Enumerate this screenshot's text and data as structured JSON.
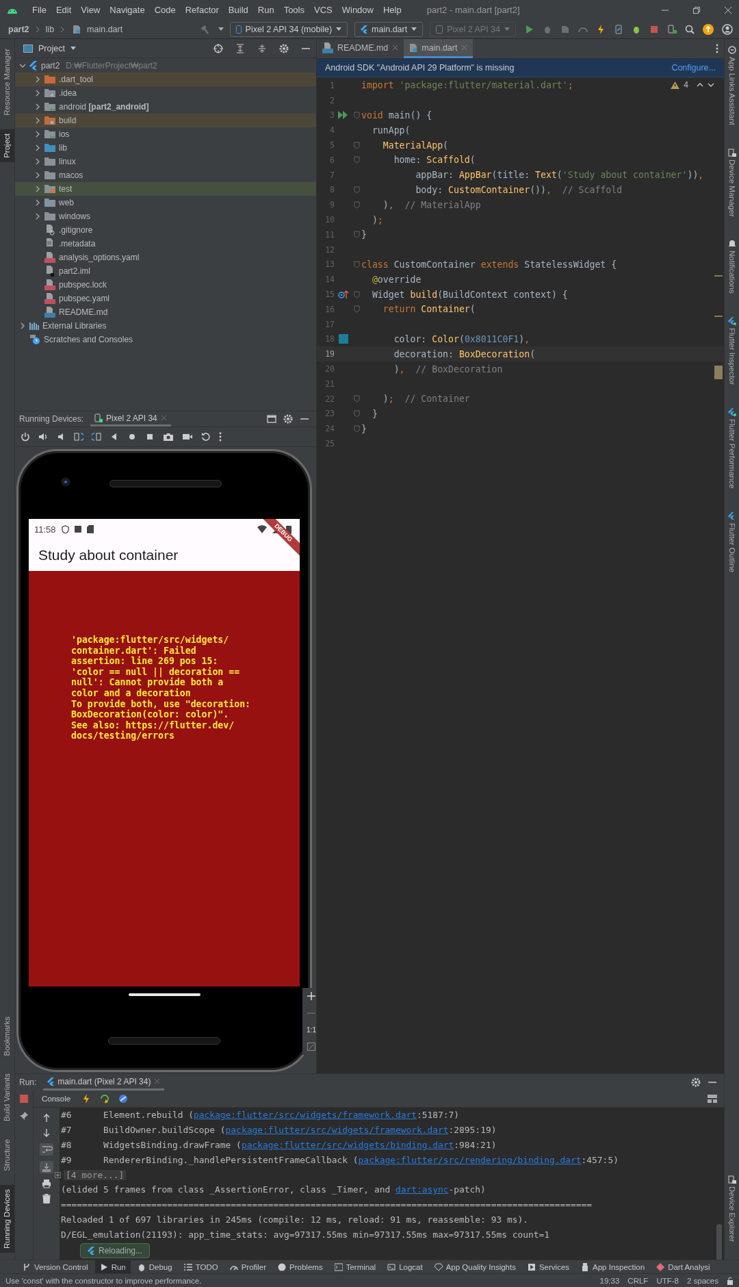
{
  "menu_bar": {
    "items": [
      "File",
      "Edit",
      "View",
      "Navigate",
      "Code",
      "Refactor",
      "Build",
      "Run",
      "Tools",
      "VCS",
      "Window",
      "Help"
    ],
    "title": "part2 - main.dart [part2]"
  },
  "nav_bar": {
    "breadcrumbs": [
      "part2",
      "lib",
      "main.dart"
    ],
    "device": "Pixel 2 API 34 (mobile)",
    "run_config": "main.dart",
    "target": {
      "label": "Pixel 2 API 34",
      "disabled": true
    }
  },
  "left_stripe": {
    "top": [
      {
        "label": "Resource Manager",
        "selected": false
      },
      {
        "label": "Project",
        "selected": true
      }
    ],
    "bottom": [
      {
        "label": "Bookmarks",
        "selected": false
      },
      {
        "label": "Build Variants",
        "selected": false
      },
      {
        "label": "Structure",
        "selected": false
      },
      {
        "label": "Running Devices",
        "selected": true
      }
    ]
  },
  "project": {
    "title": "Project",
    "tree": [
      {
        "label": "part2",
        "path": "D:₩FlutterProject₩part2",
        "kind": "flutter",
        "expanded": true,
        "children": [
          {
            "label": ".dart_tool",
            "kind": "folder-excluded",
            "expanded": false,
            "excluded": true,
            "tests": false
          },
          {
            "label": ".idea",
            "kind": "folder-settings",
            "expanded": false,
            "excluded": false,
            "tests": false
          },
          {
            "label": "android **[part2_android]**",
            "kind": "folder-module",
            "expanded": false,
            "excluded": false,
            "tests": false
          },
          {
            "label": "build",
            "kind": "folder-excluded-settings",
            "expanded": false,
            "excluded": true,
            "tests": false
          },
          {
            "label": "ios",
            "kind": "folder-module",
            "expanded": false,
            "excluded": false,
            "tests": false
          },
          {
            "label": "lib",
            "kind": "folder-source",
            "expanded": false,
            "excluded": false,
            "tests": false
          },
          {
            "label": "linux",
            "kind": "folder",
            "expanded": false,
            "excluded": false,
            "tests": false
          },
          {
            "label": "macos",
            "kind": "folder",
            "expanded": false,
            "excluded": false,
            "tests": false
          },
          {
            "label": "test",
            "kind": "folder-test",
            "expanded": false,
            "excluded": false,
            "tests": true
          },
          {
            "label": "web",
            "kind": "folder-web",
            "expanded": false,
            "excluded": false,
            "tests": false
          },
          {
            "label": "windows",
            "kind": "folder",
            "expanded": false,
            "excluded": false,
            "tests": false
          },
          {
            "label": ".gitignore",
            "kind": "file-ignore",
            "excluded": false,
            "tests": false
          },
          {
            "label": ".metadata",
            "kind": "file-text",
            "excluded": false,
            "tests": false
          },
          {
            "label": "analysis_options.yaml",
            "kind": "file-yaml",
            "excluded": false,
            "tests": false
          },
          {
            "label": "part2.iml",
            "kind": "file-iml",
            "excluded": false,
            "tests": false
          },
          {
            "label": "pubspec.lock",
            "kind": "file-yaml",
            "excluded": false,
            "tests": false
          },
          {
            "label": "pubspec.yaml",
            "kind": "file-yaml",
            "excluded": false,
            "tests": false
          },
          {
            "label": "README.md",
            "kind": "file-md",
            "excluded": false,
            "tests": false
          }
        ]
      },
      {
        "label": "External Libraries",
        "kind": "libraries",
        "expanded": false
      },
      {
        "label": "Scratches and Consoles",
        "kind": "scratches"
      }
    ]
  },
  "running_devices": {
    "title": "Running Devices:",
    "tab": "Pixel 2 API 34",
    "phone": {
      "time": "11:58",
      "app_bar_title": "Study about container",
      "debug_banner": "DEBUG",
      "error": "'package:flutter/src/widgets/\ncontainer.dart': Failed\nassertion: line 269 pos 15:\n'color == null || decoration ==\nnull': Cannot provide both a\ncolor and a decoration\nTo provide both, use \"decoration:\nBoxDecoration(color: color)\".\nSee also: https://flutter.dev/\ndocs/testing/errors",
      "zoom_label": "1:1"
    }
  },
  "editor": {
    "tabs": [
      {
        "label": "README.md",
        "kind": "md",
        "selected": false
      },
      {
        "label": "main.dart",
        "kind": "dart",
        "selected": true
      }
    ],
    "banner": {
      "text": "Android SDK \"Android API 29 Platform\" is missing",
      "action": "Configure..."
    },
    "warnings": "4",
    "lines": [
      {
        "n": "1",
        "current": false,
        "fold": false,
        "tokens": [
          {
            "t": "import ",
            "kind": "kw"
          },
          {
            "t": "'package:flutter/material.dart'",
            "kind": "str"
          },
          {
            "t": ";",
            "kind": "kw"
          }
        ]
      },
      {
        "n": "2",
        "current": false,
        "fold": false
      },
      {
        "n": "3",
        "current": false,
        "fold": true,
        "gutter": {
          "kind": "run"
        },
        "tokens": [
          {
            "t": "void ",
            "kind": "kw"
          },
          {
            "t": "main() {",
            "kind": "p"
          }
        ]
      },
      {
        "n": "4",
        "current": false,
        "fold": false,
        "tokens": [
          {
            "t": "  runApp(",
            "kind": "p"
          }
        ]
      },
      {
        "n": "5",
        "current": false,
        "fold": true,
        "tokens": [
          {
            "t": "    MaterialApp",
            "kind": "fn"
          },
          {
            "t": "(",
            "kind": "p"
          }
        ]
      },
      {
        "n": "6",
        "current": false,
        "fold": true,
        "tokens": [
          {
            "t": "      home: ",
            "kind": "p"
          },
          {
            "t": "Scaffold",
            "kind": "fn"
          },
          {
            "t": "(",
            "kind": "p"
          }
        ]
      },
      {
        "n": "7",
        "current": false,
        "fold": false,
        "tokens": [
          {
            "t": "          appBar: ",
            "kind": "p"
          },
          {
            "t": "AppBar",
            "kind": "fn"
          },
          {
            "t": "(title: ",
            "kind": "p"
          },
          {
            "t": "Text",
            "kind": "fn"
          },
          {
            "t": "(",
            "kind": "p"
          },
          {
            "t": "'Study about container'",
            "kind": "str"
          },
          {
            "t": "))",
            "kind": "p"
          },
          {
            "t": ",",
            "kind": "kw"
          }
        ]
      },
      {
        "n": "8",
        "current": false,
        "fold": true,
        "tokens": [
          {
            "t": "          body: ",
            "kind": "p"
          },
          {
            "t": "CustomContainer",
            "kind": "fn"
          },
          {
            "t": "())",
            "kind": "p"
          },
          {
            "t": ",",
            "kind": "kw"
          },
          {
            "t": "  // Scaffold",
            "kind": "cm"
          }
        ]
      },
      {
        "n": "9",
        "current": false,
        "fold": true,
        "tokens": [
          {
            "t": "    )",
            "kind": "p"
          },
          {
            "t": ",",
            "kind": "kw"
          },
          {
            "t": "  // MaterialApp",
            "kind": "cm"
          }
        ]
      },
      {
        "n": "10",
        "current": false,
        "fold": false,
        "tokens": [
          {
            "t": "  )",
            "kind": "p"
          },
          {
            "t": ";",
            "kind": "kw"
          }
        ]
      },
      {
        "n": "11",
        "current": false,
        "fold": true,
        "tokens": [
          {
            "t": "}",
            "kind": "p"
          }
        ]
      },
      {
        "n": "12",
        "current": false,
        "fold": false
      },
      {
        "n": "13",
        "current": false,
        "fold": true,
        "tokens": [
          {
            "t": "class ",
            "kind": "kw"
          },
          {
            "t": "CustomContainer ",
            "kind": "p"
          },
          {
            "t": "extends ",
            "kind": "kw"
          },
          {
            "t": "StatelessWidget {",
            "kind": "p"
          }
        ]
      },
      {
        "n": "14",
        "current": false,
        "fold": false,
        "tokens": [
          {
            "t": "  @",
            "kind": "an"
          },
          {
            "t": "override",
            "kind": "p"
          }
        ]
      },
      {
        "n": "15",
        "current": false,
        "fold": true,
        "gutter": {
          "kind": "override"
        },
        "tokens": [
          {
            "t": "  Widget ",
            "kind": "p"
          },
          {
            "t": "build",
            "kind": "fn"
          },
          {
            "t": "(BuildContext context) {",
            "kind": "p"
          }
        ]
      },
      {
        "n": "16",
        "current": false,
        "fold": true,
        "tokens": [
          {
            "t": "    return ",
            "kind": "kw"
          },
          {
            "t": "Container",
            "kind": "fn"
          },
          {
            "t": "(",
            "kind": "p"
          }
        ]
      },
      {
        "n": "17",
        "current": false,
        "fold": false
      },
      {
        "n": "18",
        "current": false,
        "fold": false,
        "gutter": {
          "kind": "color"
        },
        "tokens": [
          {
            "t": "      color: ",
            "kind": "p"
          },
          {
            "t": "Color",
            "kind": "fn"
          },
          {
            "t": "(",
            "kind": "p"
          },
          {
            "t": "0x8011C0F1",
            "kind": "num"
          },
          {
            "t": ")",
            "kind": "p"
          },
          {
            "t": ",",
            "kind": "kw"
          }
        ]
      },
      {
        "n": "19",
        "current": true,
        "fold": false,
        "tokens": [
          {
            "t": "      decoration: ",
            "kind": "p"
          },
          {
            "t": "BoxDecoration",
            "kind": "fn"
          },
          {
            "t": "(",
            "kind": "p"
          }
        ]
      },
      {
        "n": "20",
        "current": false,
        "fold": false,
        "tokens": [
          {
            "t": "      )",
            "kind": "p"
          },
          {
            "t": ",",
            "kind": "kw"
          },
          {
            "t": "  // BoxDecoration",
            "kind": "cm"
          }
        ]
      },
      {
        "n": "21",
        "current": false,
        "fold": false
      },
      {
        "n": "22",
        "current": false,
        "fold": true,
        "tokens": [
          {
            "t": "    )",
            "kind": "p"
          },
          {
            "t": ";",
            "kind": "kw"
          },
          {
            "t": "  // Container",
            "kind": "cm"
          }
        ]
      },
      {
        "n": "23",
        "current": false,
        "fold": true,
        "tokens": [
          {
            "t": "  }",
            "kind": "p"
          }
        ]
      },
      {
        "n": "24",
        "current": false,
        "fold": true,
        "tokens": [
          {
            "t": "}",
            "kind": "p"
          }
        ]
      },
      {
        "n": "25",
        "current": false,
        "fold": false
      }
    ]
  },
  "run": {
    "title": "Run:",
    "tab": "main.dart (Pixel 2 API 34)",
    "console_tab": "Console",
    "toast": "Reloading...",
    "lines": [
      {
        "kind": "text",
        "parts": [
          {
            "t": "#6      Element.rebuild (",
            "link": false
          },
          {
            "t": "package:flutter/src/widgets/framework.dart",
            "link": true
          },
          {
            "t": ":5187:7)",
            "link": false
          }
        ]
      },
      {
        "kind": "text",
        "parts": [
          {
            "t": "#7      BuildOwner.buildScope (",
            "link": false
          },
          {
            "t": "package:flutter/src/widgets/framework.dart",
            "link": true
          },
          {
            "t": ":2895:19)",
            "link": false
          }
        ]
      },
      {
        "kind": "text",
        "parts": [
          {
            "t": "#8      WidgetsBinding.drawFrame (",
            "link": false
          },
          {
            "t": "package:flutter/src/widgets/binding.dart",
            "link": true
          },
          {
            "t": ":984:21)",
            "link": false
          }
        ]
      },
      {
        "kind": "text",
        "parts": [
          {
            "t": "#9      RendererBinding._handlePersistentFrameCallback (",
            "link": false
          },
          {
            "t": "package:flutter/src/rendering/binding.dart",
            "link": true
          },
          {
            "t": ":457:5)",
            "link": false
          }
        ]
      },
      {
        "kind": "fold",
        "parts": [
          {
            "t": "[4 more...]",
            "link": false
          }
        ]
      },
      {
        "kind": "text",
        "parts": [
          {
            "t": "(elided 5 frames from class _AssertionError, class _Timer, and ",
            "link": false
          },
          {
            "t": "dart:async",
            "link": true
          },
          {
            "t": "-patch)",
            "link": false
          }
        ]
      },
      {
        "kind": "text",
        "parts": [
          {
            "t": "====================================================================================================",
            "link": false
          }
        ]
      },
      {
        "kind": "text",
        "parts": [
          {
            "t": "Reloaded 1 of 697 libraries in 245ms (compile: 12 ms, reload: 91 ms, reassemble: 93 ms).",
            "link": false
          }
        ]
      },
      {
        "kind": "text",
        "parts": [
          {
            "t": "D/EGL_emulation(21193): app_time_stats: avg=97317.55ms min=97317.55ms max=97317.55ms count=1",
            "link": false
          }
        ]
      }
    ]
  },
  "right_stripe": {
    "top": [
      {
        "label": "App Links Assistant",
        "kind": "link"
      },
      {
        "label": "Device Manager",
        "kind": "device"
      },
      {
        "label": "Notifications",
        "kind": "bell"
      },
      {
        "label": "Flutter Inspector",
        "kind": "flutter"
      },
      {
        "label": "Flutter Performance",
        "kind": "flutter"
      },
      {
        "label": "Flutter Outline",
        "kind": "flutter-plain"
      }
    ],
    "bottom": [
      {
        "label": "Device Explorer",
        "kind": "device"
      }
    ]
  },
  "tool_windows": [
    {
      "label": "Version Control",
      "kind": "vcs",
      "selected": false
    },
    {
      "label": "Run",
      "kind": "run",
      "selected": true
    },
    {
      "label": "Debug",
      "kind": "debug",
      "selected": false
    },
    {
      "label": "TODO",
      "kind": "list",
      "selected": false
    },
    {
      "label": "Profiler",
      "kind": "gauge",
      "selected": false
    },
    {
      "label": "Problems",
      "kind": "problems",
      "selected": false
    },
    {
      "label": "Terminal",
      "kind": "terminal",
      "selected": false
    },
    {
      "label": "Logcat",
      "kind": "cat",
      "selected": false
    },
    {
      "label": "App Quality Insights",
      "kind": "diamond",
      "selected": false
    },
    {
      "label": "Services",
      "kind": "services",
      "selected": false
    },
    {
      "label": "App Inspection",
      "kind": "inspect",
      "selected": false
    },
    {
      "label": "Dart Analysi",
      "kind": "analysis",
      "selected": false
    }
  ],
  "status_bar": {
    "message": "Use 'const' with the constructor to improve performance.",
    "items": [
      "19:33",
      "CRLF",
      "UTF-8",
      "2 spaces"
    ]
  }
}
